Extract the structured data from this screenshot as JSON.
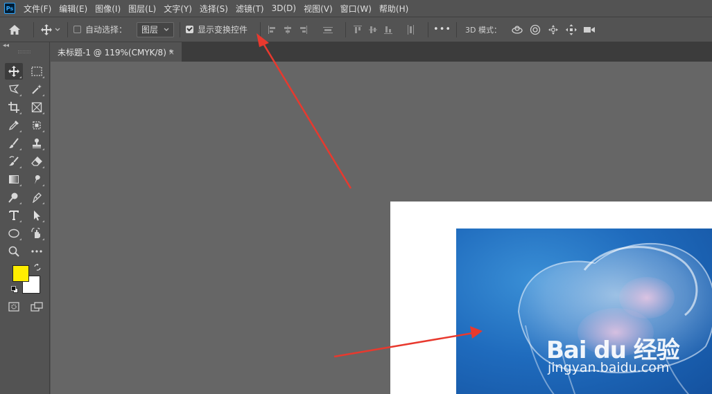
{
  "app": {
    "logo_text": "Ps"
  },
  "menu": [
    {
      "label": "文件(F)"
    },
    {
      "label": "编辑(E)"
    },
    {
      "label": "图像(I)"
    },
    {
      "label": "图层(L)"
    },
    {
      "label": "文字(Y)"
    },
    {
      "label": "选择(S)"
    },
    {
      "label": "滤镜(T)"
    },
    {
      "label": "3D(D)"
    },
    {
      "label": "视图(V)"
    },
    {
      "label": "窗口(W)"
    },
    {
      "label": "帮助(H)"
    }
  ],
  "options": {
    "auto_select_label": "自动选择：",
    "auto_select_checked": false,
    "layer_select_value": "图层",
    "show_transform_label": "显示变换控件",
    "show_transform_checked": true,
    "more_label": "•••",
    "mode3d_label": "3D 模式："
  },
  "document_tab": {
    "title": "未标题-1 @ 119%(CMYK/8) *",
    "close_label": "×"
  },
  "colors": {
    "foreground": "#ffee00",
    "background": "#ffffff",
    "arrow": "#e8392e"
  },
  "watermark": {
    "main": "Bai du 经验",
    "sub": "jingyan.baidu.com"
  }
}
